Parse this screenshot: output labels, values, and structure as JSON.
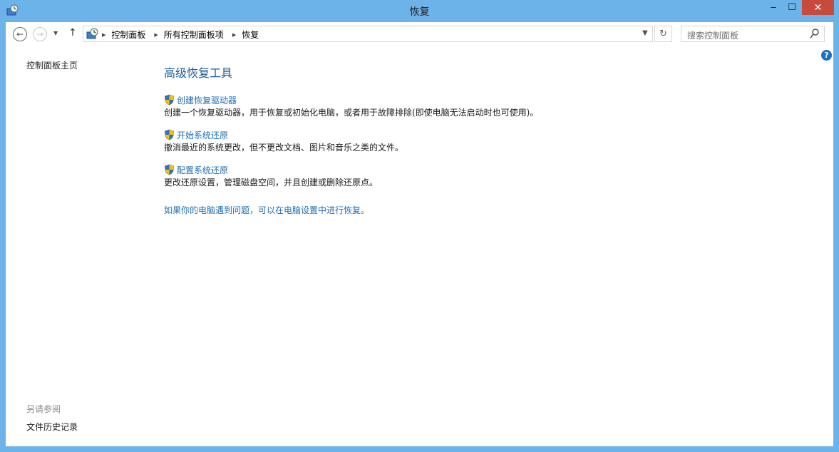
{
  "window": {
    "title": "恢复"
  },
  "titlebar": {
    "minimize": "‒",
    "maximize": "☐",
    "close": "✕"
  },
  "nav": {
    "back": "←",
    "forward": "→",
    "recent": "▼",
    "up": "↑",
    "breadcrumbs": [
      "控制面板",
      "所有控制面板项",
      "恢复"
    ],
    "refresh": "↻",
    "search_placeholder": "搜索控制面板"
  },
  "help": {
    "label": "?"
  },
  "sidebar": {
    "home": "控制面板主页",
    "see_also_title": "另请参阅",
    "file_history": "文件历史记录"
  },
  "main": {
    "heading": "高级恢复工具",
    "tasks": [
      {
        "title": "创建恢复驱动器",
        "desc": "创建一个恢复驱动器，用于恢复或初始化电脑，或者用于故障排除(即使电脑无法启动时也可使用)。"
      },
      {
        "title": "开始系统还原",
        "desc": "撤消最近的系统更改，但不更改文档、图片和音乐之类的文件。"
      },
      {
        "title": "配置系统还原",
        "desc": "更改还原设置，管理磁盘空间，并且创建或删除还原点。"
      }
    ],
    "pc_settings_link": "如果你的电脑遇到问题，可以在电脑设置中进行恢复。"
  },
  "colors": {
    "frame": "#6cb3e9",
    "close": "#c74a3f",
    "link": "#1f6fb5",
    "heading": "#1b5c96"
  }
}
